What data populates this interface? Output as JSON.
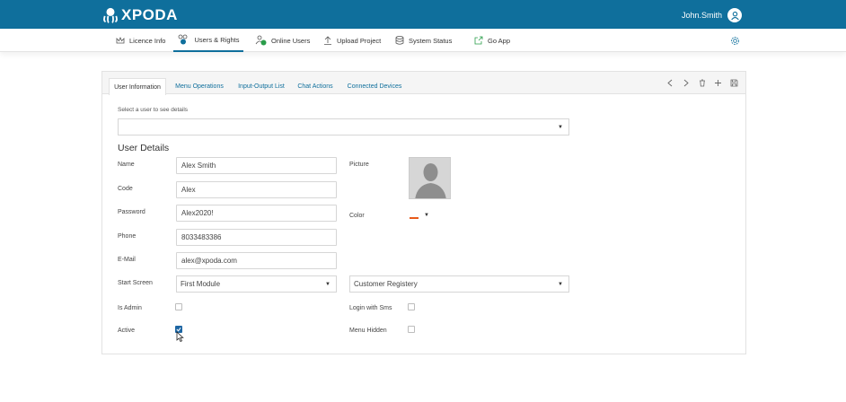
{
  "header": {
    "brand": "XPODA",
    "user_name": "John.Smith",
    "bg_color": "#0f6f9c"
  },
  "nav": {
    "items": [
      {
        "label": "Licence Info",
        "icon": "crown-icon"
      },
      {
        "label": "Users & Rights",
        "icon": "users-rights-icon",
        "active": true
      },
      {
        "label": "Online Users",
        "icon": "online-users-icon"
      },
      {
        "label": "Upload Project",
        "icon": "upload-icon"
      },
      {
        "label": "System Status",
        "icon": "database-icon"
      },
      {
        "label": "Go App",
        "icon": "external-link-icon"
      }
    ],
    "settings_icon": "gear-icon"
  },
  "tabs": [
    {
      "label": "User Information",
      "active": true
    },
    {
      "label": "Menu Operations"
    },
    {
      "label": "Input-Output List"
    },
    {
      "label": "Chat Actions"
    },
    {
      "label": "Connected Devices"
    }
  ],
  "toolbar": {
    "prev_icon": "chevron-left-icon",
    "next_icon": "chevron-right-icon",
    "delete_icon": "trash-icon",
    "add_icon": "plus-icon",
    "save_icon": "save-icon"
  },
  "form": {
    "select_hint": "Select a user to see details",
    "user_select_value": "",
    "section_title": "User Details",
    "name_label": "Name",
    "name_value": "Alex Smith",
    "code_label": "Code",
    "code_value": "Alex",
    "password_label": "Password",
    "password_value": "Alex2020!",
    "phone_label": "Phone",
    "phone_value": "8033483386",
    "email_label": "E-Mail",
    "email_value": "alex@xpoda.com",
    "start_screen_label": "Start Screen",
    "start_screen_value": "First Module",
    "start_screen_module_value": "Customer Registery",
    "is_admin_label": "Is Admin",
    "is_admin_checked": false,
    "active_label": "Active",
    "active_checked": true,
    "picture_label": "Picture",
    "color_label": "Color",
    "color_value": "#e85a1a",
    "login_sms_label": "Login with Sms",
    "login_sms_checked": false,
    "menu_hidden_label": "Menu Hidden",
    "menu_hidden_checked": false
  }
}
